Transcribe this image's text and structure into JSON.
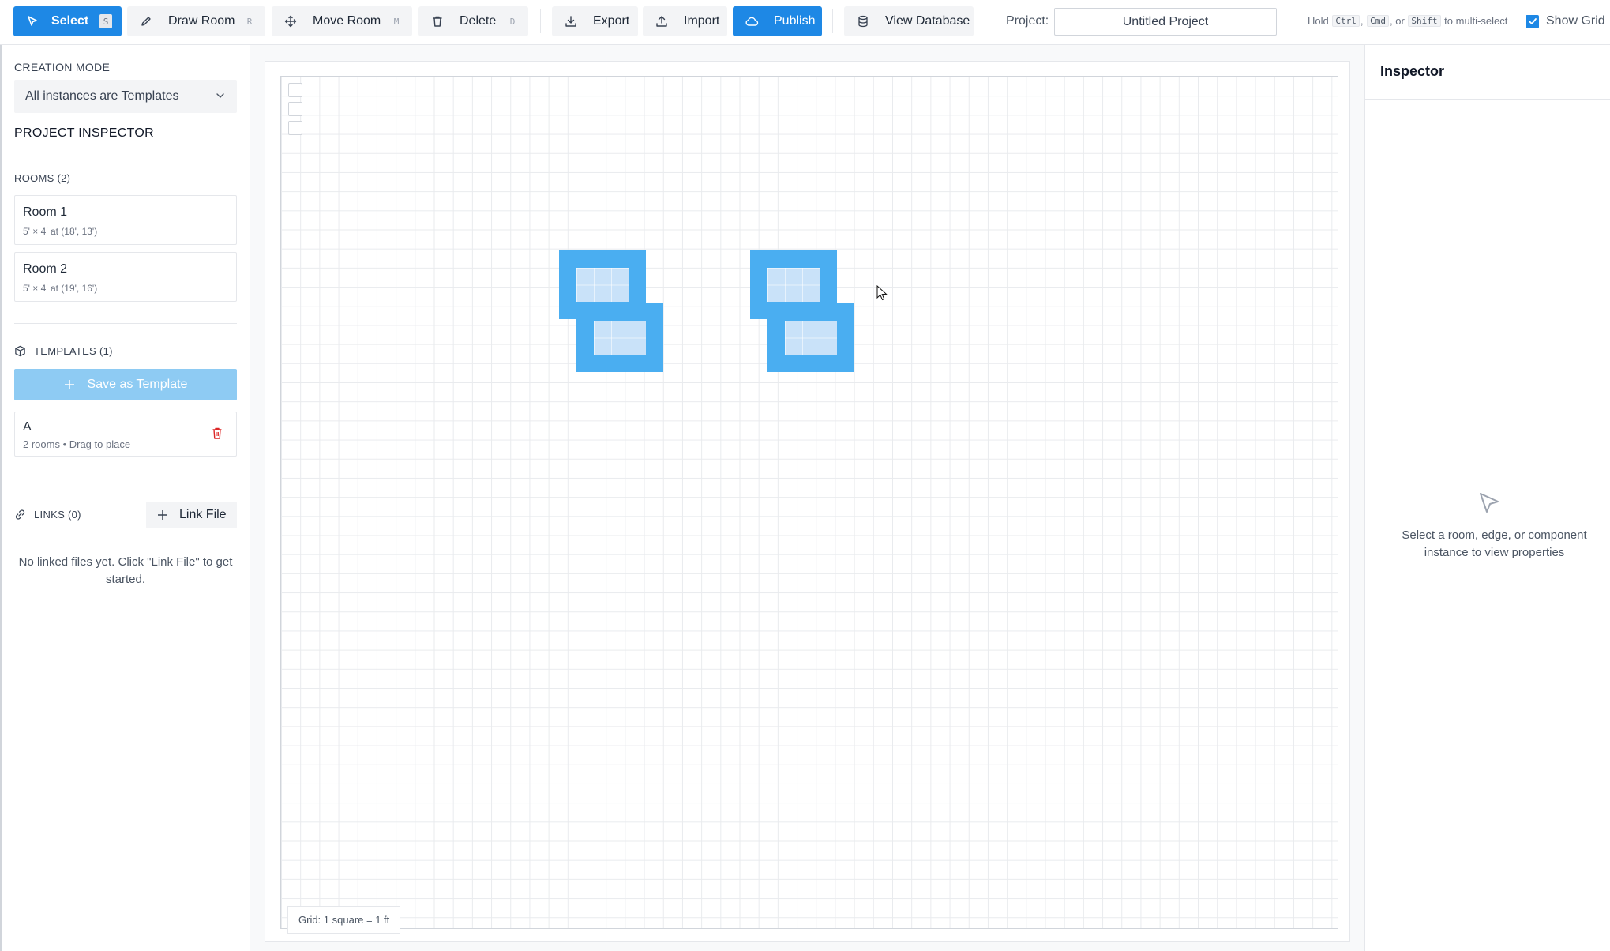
{
  "toolbar": {
    "select": {
      "label": "Select",
      "shortcut": "S"
    },
    "draw_room": {
      "label": "Draw Room",
      "shortcut": "R"
    },
    "move_room": {
      "label": "Move Room",
      "shortcut": "M"
    },
    "delete": {
      "label": "Delete",
      "shortcut": "D"
    },
    "export": {
      "label": "Export"
    },
    "import": {
      "label": "Import"
    },
    "publish": {
      "label": "Publish"
    },
    "view_database": {
      "label": "View Database"
    },
    "project_label": "Project:",
    "project_name": "Untitled Project",
    "hint": {
      "prefix": "Hold",
      "key1": "Ctrl",
      "sep1": ",",
      "key2": "Cmd",
      "sep2": ", or",
      "key3": "Shift",
      "suffix": "to multi-select"
    },
    "show_grid": {
      "label": "Show Grid",
      "checked": true
    }
  },
  "sidebar": {
    "creation_mode_title": "CREATION MODE",
    "creation_mode_value": "All instances are Templates",
    "project_inspector_title": "PROJECT INSPECTOR",
    "rooms_title": "ROOMS (2)",
    "rooms": [
      {
        "name": "Room 1",
        "detail": "5' × 4' at (18', 13')"
      },
      {
        "name": "Room 2",
        "detail": "5' × 4' at (19', 16')"
      }
    ],
    "templates_title": "TEMPLATES (1)",
    "save_template_label": "Save as Template",
    "templates": [
      {
        "name": "A",
        "detail": "2 rooms • Drag to place"
      }
    ],
    "links_title": "LINKS (0)",
    "link_file_label": "Link File",
    "links_empty": "No linked files yet. Click \"Link File\" to get started."
  },
  "canvas": {
    "grid_legend": "Grid: 1 square = 1 ft"
  },
  "inspector": {
    "title": "Inspector",
    "empty_message": "Select a room, edge, or component instance to view properties"
  },
  "colors": {
    "primary": "#1e88e5",
    "room_wall": "#4aaef1",
    "room_floor": "#c9e2f9",
    "save_template_disabled": "#8ecbf3",
    "delete_red": "#dc2626"
  }
}
